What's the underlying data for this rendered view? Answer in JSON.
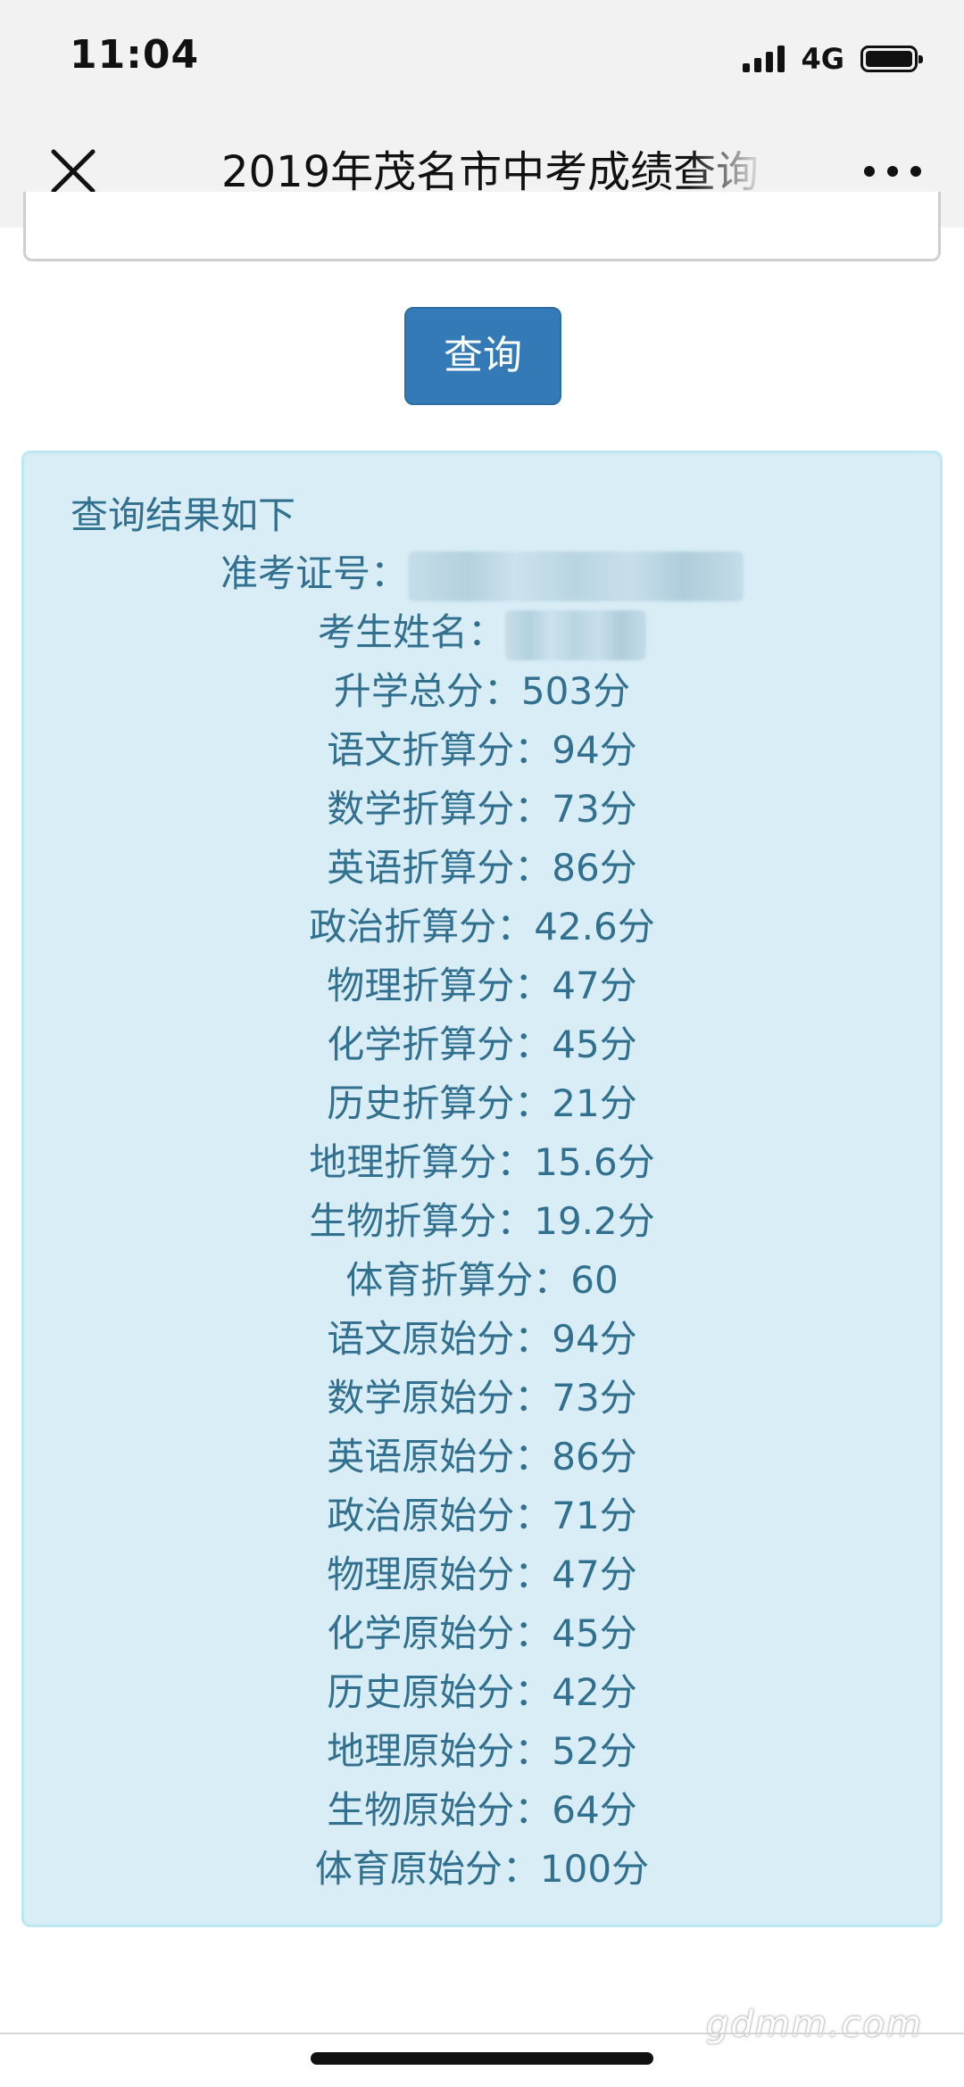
{
  "status_bar": {
    "time": "11:04",
    "network": "4G",
    "icons": [
      "signal-icon",
      "battery-icon"
    ]
  },
  "nav": {
    "title": "2019年茂名市中考成绩查询",
    "close_icon": "close-icon",
    "more_icon": "more-icon"
  },
  "form": {
    "query_label": "查询"
  },
  "result": {
    "heading": "查询结果如下",
    "exam_id_label": "准考证号：",
    "name_label": "考生姓名：",
    "rows": [
      {
        "label": "升学总分：",
        "value": "503分"
      },
      {
        "label": "语文折算分：",
        "value": "94分"
      },
      {
        "label": "数学折算分：",
        "value": "73分"
      },
      {
        "label": "英语折算分：",
        "value": "86分"
      },
      {
        "label": "政治折算分：",
        "value": "42.6分"
      },
      {
        "label": "物理折算分：",
        "value": "47分"
      },
      {
        "label": "化学折算分：",
        "value": "45分"
      },
      {
        "label": "历史折算分：",
        "value": "21分"
      },
      {
        "label": "地理折算分：",
        "value": "15.6分"
      },
      {
        "label": "生物折算分：",
        "value": "19.2分"
      },
      {
        "label": "体育折算分：",
        "value": "60"
      },
      {
        "label": "语文原始分：",
        "value": "94分"
      },
      {
        "label": "数学原始分：",
        "value": "73分"
      },
      {
        "label": "英语原始分：",
        "value": "86分"
      },
      {
        "label": "政治原始分：",
        "value": "71分"
      },
      {
        "label": "物理原始分：",
        "value": "47分"
      },
      {
        "label": "化学原始分：",
        "value": "45分"
      },
      {
        "label": "历史原始分：",
        "value": "42分"
      },
      {
        "label": "地理原始分：",
        "value": "52分"
      },
      {
        "label": "生物原始分：",
        "value": "64分"
      },
      {
        "label": "体育原始分：",
        "value": "100分"
      }
    ]
  },
  "watermark": "gdmm.com",
  "colors": {
    "button_bg": "#337ab7",
    "panel_bg": "#d9edf7",
    "panel_border": "#bce8f1",
    "panel_text": "#31708f"
  }
}
